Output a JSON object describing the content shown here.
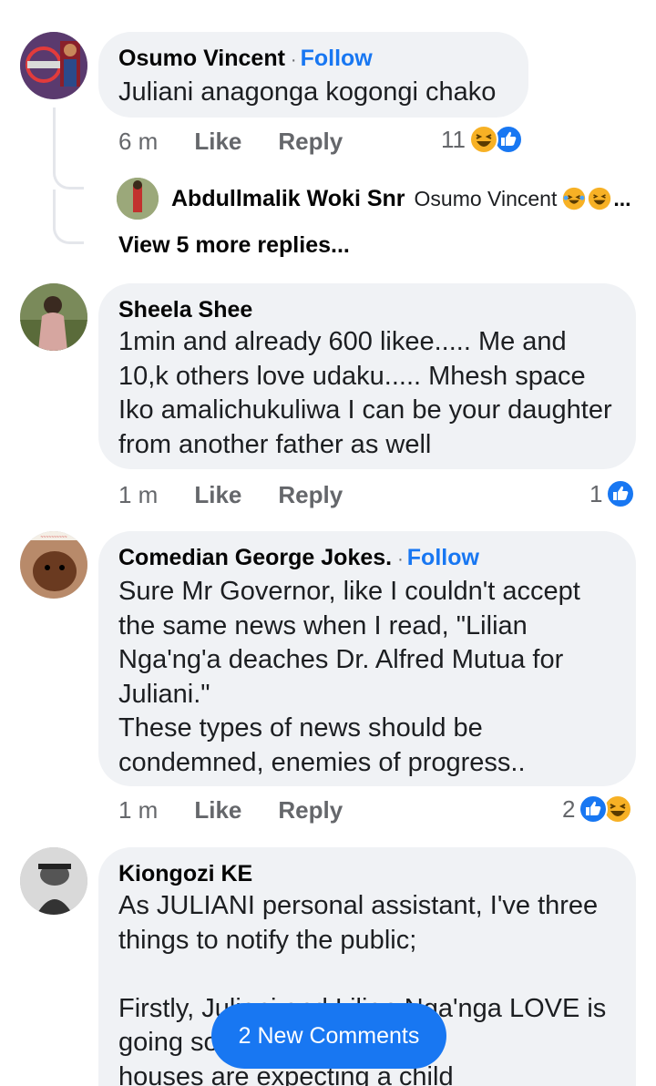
{
  "comments": [
    {
      "author": "Osumo Vincent",
      "follow_label": "Follow",
      "follow_sep": "·",
      "text": "Juliani anagonga kogongi chako",
      "time": "6 m",
      "like_label": "Like",
      "reply_label": "Reply",
      "reaction_count": "11",
      "reactions": [
        "haha-icon",
        "like-icon"
      ],
      "replies_preview": {
        "author": "Abdullmalik Woki Snr",
        "text": "Osumo Vincent",
        "reactions": [
          "laugh-tears-icon",
          "haha-icon"
        ],
        "ellipsis": "..."
      },
      "view_more_label": "View 5 more replies..."
    },
    {
      "author": "Sheela Shee",
      "text": "1min and already 600 likee..... Me and\n10,k others love udaku..... Mhesh space\nIko amalichukuliwa I can be your daughter\nfrom another father as well",
      "time": "1 m",
      "like_label": "Like",
      "reply_label": "Reply",
      "reaction_count": "1",
      "reactions": [
        "like-icon"
      ]
    },
    {
      "author": "Comedian George Jokes.",
      "follow_label": "Follow",
      "follow_sep": "·",
      "text": "Sure Mr Governor, like I couldn't accept\nthe same news when I read, \"Lilian\nNga'ng'a deaches Dr. Alfred Mutua for\nJuliani.\"\nThese types of news should be\ncondemned, enemies of progress..",
      "time": "1 m",
      "like_label": "Like",
      "reply_label": "Reply",
      "reaction_count": "2",
      "reactions": [
        "like-icon",
        "haha-icon"
      ]
    },
    {
      "author": "Kiongozi KE",
      "text": "As JULIANI personal assistant, I've three\nthings to notify the public;\n\nFirstly, Juliani and Lilian Nga'nga LOVE is\ngoing so       , my two\nhouses are expecting a child"
    }
  ],
  "new_comments_label": "2 New Comments",
  "colors": {
    "accent": "#1877f2",
    "bubble": "#f0f2f5",
    "meta_text": "#65676b",
    "haha": "#f7b125",
    "like": "#1877f2"
  }
}
